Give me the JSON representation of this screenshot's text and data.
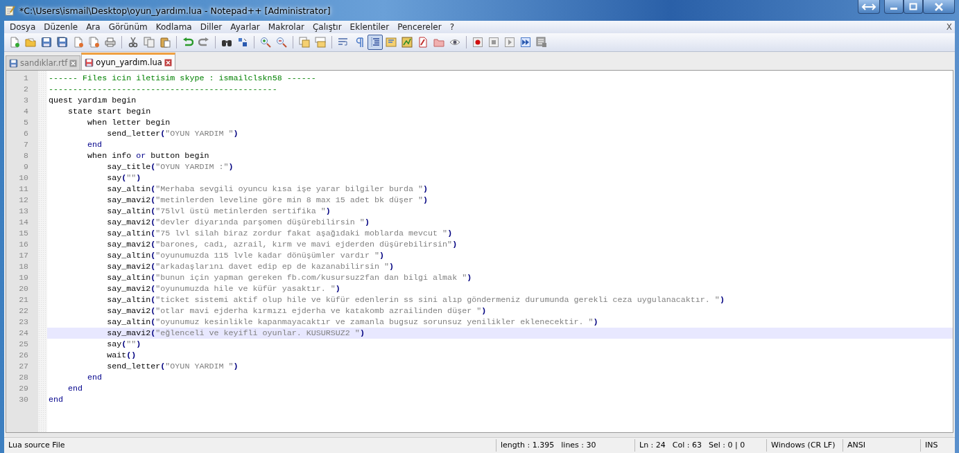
{
  "window": {
    "title": "*C:\\Users\\ismail\\Desktop\\oyun_yardım.lua - Notepad++ [Administrator]"
  },
  "menu": {
    "items": [
      "Dosya",
      "Düzenle",
      "Ara",
      "Görünüm",
      "Kodlama",
      "Diller",
      "Ayarlar",
      "Makrolar",
      "Çalıştır",
      "Eklentiler",
      "Pencereler",
      "?"
    ],
    "close": "X"
  },
  "toolbar": [
    {
      "kind": "new",
      "pressed": false
    },
    {
      "kind": "open",
      "pressed": false
    },
    {
      "kind": "save",
      "pressed": false
    },
    {
      "kind": "saveall",
      "pressed": false
    },
    {
      "kind": "close",
      "pressed": false
    },
    {
      "kind": "closeall",
      "pressed": false
    },
    {
      "kind": "print",
      "pressed": false
    },
    {
      "kind": "sep"
    },
    {
      "kind": "cut",
      "pressed": false
    },
    {
      "kind": "copy",
      "pressed": false
    },
    {
      "kind": "paste",
      "pressed": false
    },
    {
      "kind": "sep"
    },
    {
      "kind": "undo",
      "pressed": false
    },
    {
      "kind": "redo",
      "pressed": false
    },
    {
      "kind": "sep"
    },
    {
      "kind": "find",
      "pressed": false
    },
    {
      "kind": "replace",
      "pressed": false
    },
    {
      "kind": "sep"
    },
    {
      "kind": "zoomin",
      "pressed": false
    },
    {
      "kind": "zoomout",
      "pressed": false
    },
    {
      "kind": "sep"
    },
    {
      "kind": "syncv",
      "pressed": false
    },
    {
      "kind": "synch",
      "pressed": false
    },
    {
      "kind": "sep"
    },
    {
      "kind": "wrap",
      "pressed": false
    },
    {
      "kind": "pilcrow",
      "pressed": false
    },
    {
      "kind": "guides",
      "pressed": true
    },
    {
      "kind": "lang",
      "pressed": false
    },
    {
      "kind": "map",
      "pressed": false
    },
    {
      "kind": "doc",
      "pressed": false
    },
    {
      "kind": "folder",
      "pressed": false
    },
    {
      "kind": "eye",
      "pressed": false
    },
    {
      "kind": "sep"
    },
    {
      "kind": "record",
      "pressed": false
    },
    {
      "kind": "stop",
      "pressed": false
    },
    {
      "kind": "play",
      "pressed": false
    },
    {
      "kind": "playmulti",
      "pressed": false
    },
    {
      "kind": "savemacro",
      "pressed": false
    }
  ],
  "tabs": [
    {
      "label": "sandıklar.rtf",
      "selected": false,
      "modified": false
    },
    {
      "label": "oyun_yardım.lua",
      "selected": true,
      "modified": true
    }
  ],
  "editor": {
    "lines": [
      {
        "number": "1",
        "current": false,
        "tokens": [
          {
            "kind": "comment",
            "text": "------ Files icin iletisim skype : ismailclskn58 ------"
          }
        ]
      },
      {
        "number": "2",
        "current": false,
        "tokens": [
          {
            "kind": "comment",
            "text": "-----------------------------------------------"
          }
        ]
      },
      {
        "number": "3",
        "current": false,
        "tokens": [
          {
            "kind": "plain",
            "text": "quest yardım begin"
          }
        ],
        "children": [
          {
            "number": "4",
            "current": false,
            "tokens": [
              {
                "kind": "plain",
                "text": "state start begin"
              }
            ],
            "children": [
              {
                "number": "5",
                "current": false,
                "tokens": [
                  {
                    "kind": "plain",
                    "text": "when letter begin"
                  }
                ],
                "children": [
                  {
                    "number": "6",
                    "current": false,
                    "tokens": [
                      {
                        "kind": "plain",
                        "text": "send_letter"
                      },
                      {
                        "kind": "operator",
                        "text": "("
                      },
                      {
                        "kind": "string",
                        "text": "\"OYUN YARDIM \""
                      },
                      {
                        "kind": "operator",
                        "text": ")"
                      }
                    ]
                  }
                ]
              },
              {
                "number": "7",
                "current": false,
                "tokens": [
                  {
                    "kind": "keyword",
                    "text": "end"
                  }
                ]
              },
              {
                "number": "8",
                "current": false,
                "tokens": [
                  {
                    "kind": "plain",
                    "text": "when info "
                  },
                  {
                    "kind": "keyword",
                    "text": "or"
                  },
                  {
                    "kind": "plain",
                    "text": " button begin"
                  }
                ],
                "children": [
                  {
                    "number": "9",
                    "current": false,
                    "tokens": [
                      {
                        "kind": "plain",
                        "text": "say_title"
                      },
                      {
                        "kind": "operator",
                        "text": "("
                      },
                      {
                        "kind": "string",
                        "text": "\"OYUN YARDIM :\""
                      },
                      {
                        "kind": "operator",
                        "text": ")"
                      }
                    ]
                  },
                  {
                    "number": "10",
                    "current": false,
                    "tokens": [
                      {
                        "kind": "plain",
                        "text": "say"
                      },
                      {
                        "kind": "operator",
                        "text": "("
                      },
                      {
                        "kind": "string",
                        "text": "\"\""
                      },
                      {
                        "kind": "operator",
                        "text": ")"
                      }
                    ]
                  },
                  {
                    "number": "11",
                    "current": false,
                    "tokens": [
                      {
                        "kind": "plain",
                        "text": "say_altin"
                      },
                      {
                        "kind": "operator",
                        "text": "("
                      },
                      {
                        "kind": "string",
                        "text": "\"Merhaba sevgili oyuncu kısa işe yarar bilgiler burda \""
                      },
                      {
                        "kind": "operator",
                        "text": ")"
                      }
                    ]
                  },
                  {
                    "number": "12",
                    "current": false,
                    "tokens": [
                      {
                        "kind": "plain",
                        "text": "say_mavi2"
                      },
                      {
                        "kind": "operator",
                        "text": "("
                      },
                      {
                        "kind": "string",
                        "text": "\"metinlerden leveline göre min 8 max 15 adet bk düşer \""
                      },
                      {
                        "kind": "operator",
                        "text": ")"
                      }
                    ]
                  },
                  {
                    "number": "13",
                    "current": false,
                    "tokens": [
                      {
                        "kind": "plain",
                        "text": "say_altin"
                      },
                      {
                        "kind": "operator",
                        "text": "("
                      },
                      {
                        "kind": "string",
                        "text": "\"75lvl üstü metinlerden sertifika \""
                      },
                      {
                        "kind": "operator",
                        "text": ")"
                      }
                    ]
                  },
                  {
                    "number": "14",
                    "current": false,
                    "tokens": [
                      {
                        "kind": "plain",
                        "text": "say_mavi2"
                      },
                      {
                        "kind": "operator",
                        "text": "("
                      },
                      {
                        "kind": "string",
                        "text": "\"devler diyarında parşomen düşürebilirsin \""
                      },
                      {
                        "kind": "operator",
                        "text": ")"
                      }
                    ]
                  },
                  {
                    "number": "15",
                    "current": false,
                    "tokens": [
                      {
                        "kind": "plain",
                        "text": "say_altin"
                      },
                      {
                        "kind": "operator",
                        "text": "("
                      },
                      {
                        "kind": "string",
                        "text": "\"75 lvl silah biraz zordur fakat aşağıdaki moblarda mevcut \""
                      },
                      {
                        "kind": "operator",
                        "text": ")"
                      }
                    ]
                  },
                  {
                    "number": "16",
                    "current": false,
                    "tokens": [
                      {
                        "kind": "plain",
                        "text": "say_mavi2"
                      },
                      {
                        "kind": "operator",
                        "text": "("
                      },
                      {
                        "kind": "string",
                        "text": "\"barones, cadı, azrail, kırm ve mavi ejderden düşürebilirsin\""
                      },
                      {
                        "kind": "operator",
                        "text": ")"
                      }
                    ]
                  },
                  {
                    "number": "17",
                    "current": false,
                    "tokens": [
                      {
                        "kind": "plain",
                        "text": "say_altin"
                      },
                      {
                        "kind": "operator",
                        "text": "("
                      },
                      {
                        "kind": "string",
                        "text": "\"oyunumuzda 115 lvle kadar dönüşümler vardır \""
                      },
                      {
                        "kind": "operator",
                        "text": ")"
                      }
                    ]
                  },
                  {
                    "number": "18",
                    "current": false,
                    "tokens": [
                      {
                        "kind": "plain",
                        "text": "say_mavi2"
                      },
                      {
                        "kind": "operator",
                        "text": "("
                      },
                      {
                        "kind": "string",
                        "text": "\"arkadaşlarını davet edip ep de kazanabilirsin \""
                      },
                      {
                        "kind": "operator",
                        "text": ")"
                      }
                    ]
                  },
                  {
                    "number": "19",
                    "current": false,
                    "tokens": [
                      {
                        "kind": "plain",
                        "text": "say_altin"
                      },
                      {
                        "kind": "operator",
                        "text": "("
                      },
                      {
                        "kind": "string",
                        "text": "\"bunun için yapman gereken fb.com/kusursuz2fan dan bilgi almak \""
                      },
                      {
                        "kind": "operator",
                        "text": ")"
                      }
                    ]
                  },
                  {
                    "number": "20",
                    "current": false,
                    "tokens": [
                      {
                        "kind": "plain",
                        "text": "say_mavi2"
                      },
                      {
                        "kind": "operator",
                        "text": "("
                      },
                      {
                        "kind": "string",
                        "text": "\"oyunumuzda hile ve küfür yasaktır. \""
                      },
                      {
                        "kind": "operator",
                        "text": ")"
                      }
                    ]
                  },
                  {
                    "number": "21",
                    "current": false,
                    "tokens": [
                      {
                        "kind": "plain",
                        "text": "say_altin"
                      },
                      {
                        "kind": "operator",
                        "text": "("
                      },
                      {
                        "kind": "string",
                        "text": "\"ticket sistemi aktif olup hile ve küfür edenlerin ss sini alıp göndermeniz durumunda gerekli ceza uygulanacaktır. \""
                      },
                      {
                        "kind": "operator",
                        "text": ")"
                      }
                    ]
                  },
                  {
                    "number": "22",
                    "current": false,
                    "tokens": [
                      {
                        "kind": "plain",
                        "text": "say_mavi2"
                      },
                      {
                        "kind": "operator",
                        "text": "("
                      },
                      {
                        "kind": "string",
                        "text": "\"otlar mavi ejderha kırmızı ejderha ve katakomb azrailinden düşer \""
                      },
                      {
                        "kind": "operator",
                        "text": ")"
                      }
                    ]
                  },
                  {
                    "number": "23",
                    "current": false,
                    "tokens": [
                      {
                        "kind": "plain",
                        "text": "say_altin"
                      },
                      {
                        "kind": "operator",
                        "text": "("
                      },
                      {
                        "kind": "string",
                        "text": "\"oyunumuz kesinlikle kapanmayacaktır ve zamanla bugsuz sorunsuz yenilikler eklenecektir. \""
                      },
                      {
                        "kind": "operator",
                        "text": ")"
                      }
                    ]
                  },
                  {
                    "number": "24",
                    "current": true,
                    "tokens": [
                      {
                        "kind": "plain",
                        "text": "say_mavi2"
                      },
                      {
                        "kind": "operator",
                        "text": "("
                      },
                      {
                        "kind": "string",
                        "text": "\"eğlenceli ve keyifli oyunlar. KUSURSUZ2 \""
                      },
                      {
                        "kind": "operator",
                        "text": ")"
                      }
                    ]
                  },
                  {
                    "number": "25",
                    "current": false,
                    "tokens": [
                      {
                        "kind": "plain",
                        "text": "say"
                      },
                      {
                        "kind": "operator",
                        "text": "("
                      },
                      {
                        "kind": "string",
                        "text": "\"\""
                      },
                      {
                        "kind": "operator",
                        "text": ")"
                      }
                    ]
                  },
                  {
                    "number": "26",
                    "current": false,
                    "tokens": [
                      {
                        "kind": "plain",
                        "text": "wait"
                      },
                      {
                        "kind": "operator",
                        "text": "()"
                      }
                    ]
                  },
                  {
                    "number": "27",
                    "current": false,
                    "tokens": [
                      {
                        "kind": "plain",
                        "text": "send_letter"
                      },
                      {
                        "kind": "operator",
                        "text": "("
                      },
                      {
                        "kind": "string",
                        "text": "\"OYUN YARDIM \""
                      },
                      {
                        "kind": "operator",
                        "text": ")"
                      }
                    ]
                  }
                ]
              },
              {
                "number": "28",
                "current": false,
                "tokens": [
                  {
                    "kind": "keyword",
                    "text": "end"
                  }
                ]
              }
            ]
          },
          {
            "number": "29",
            "current": false,
            "tokens": [
              {
                "kind": "keyword",
                "text": "end"
              }
            ]
          }
        ]
      },
      {
        "number": "30",
        "current": false,
        "tokens": [
          {
            "kind": "keyword",
            "text": "end"
          }
        ]
      }
    ]
  },
  "status_bar": {
    "file_type": "Lua source File",
    "length": "length : 1.395",
    "lines": "lines : 30",
    "ln": "Ln : 24",
    "col": "Col : 63",
    "sel": "Sel : 0 | 0",
    "eol": "Windows (CR LF)",
    "encoding": "ANSI",
    "mode": "INS"
  }
}
